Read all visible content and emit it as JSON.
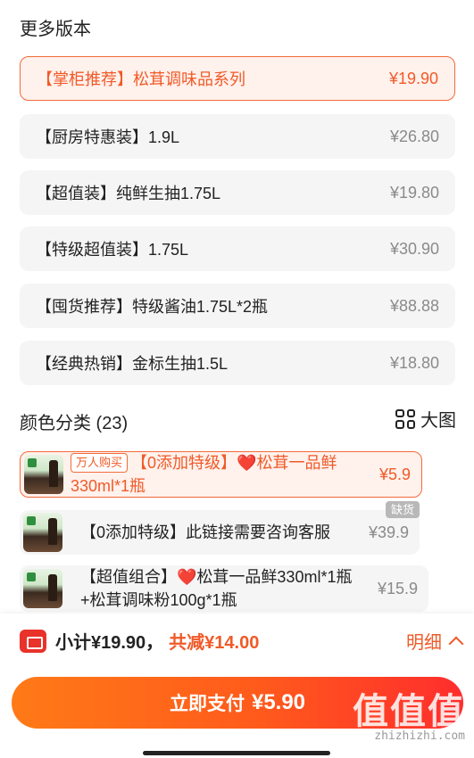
{
  "more_versions": {
    "title": "更多版本",
    "items": [
      {
        "label": "【掌柜推荐】松茸调味品系列",
        "price": "¥19.90"
      },
      {
        "label": "【厨房特惠装】1.9L",
        "price": "¥26.80"
      },
      {
        "label": "【超值装】纯鲜生抽1.75L",
        "price": "¥19.80"
      },
      {
        "label": "【特级超值装】1.75L",
        "price": "¥30.90"
      },
      {
        "label": "【囤货推荐】特级酱油1.75L*2瓶",
        "price": "¥88.88"
      },
      {
        "label": "【经典热销】金标生抽1.5L",
        "price": "¥18.80"
      }
    ]
  },
  "color_category": {
    "title": "颜色分类 (23)",
    "view_toggle": "大图",
    "items": [
      {
        "badge": "万人购买",
        "label_a": "【0添加特级】",
        "heart": "❤️",
        "label_b": "松茸一品鲜330ml*1瓶",
        "price": "¥5.9"
      },
      {
        "label": "【0添加特级】此链接需要咨询客服",
        "price": "¥39.9",
        "status": "缺货"
      },
      {
        "label_a": "【超值组合】",
        "heart": "❤️",
        "label_b": "松茸一品鲜330ml*1瓶+松茸调味粉100g*1瓶",
        "price": "¥15.9"
      }
    ]
  },
  "footer": {
    "subtotal": "小计¥19.90，",
    "discount": "共减¥14.00",
    "detail": "明细",
    "pay_label": "立即支付",
    "pay_amount": "¥5.90",
    "watermark": "值值值",
    "watermark_url": "zhizhizhi.com"
  }
}
